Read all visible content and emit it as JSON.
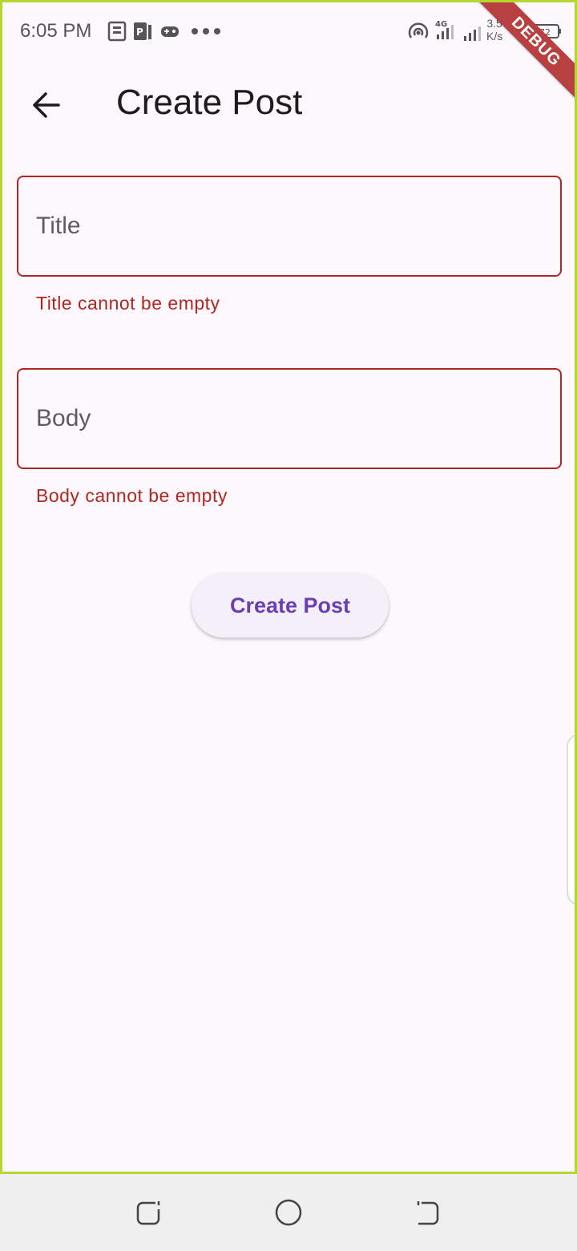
{
  "status_bar": {
    "time": "6:05 PM",
    "network_type": "4G",
    "speed_value": "3.5",
    "speed_unit": "K/s",
    "battery": "72",
    "debug_label": "DEBUG",
    "icons": [
      "news-icon",
      "pdf-icon",
      "game-icon",
      "more-dots-icon",
      "hotspot-icon",
      "signal-4g-icon",
      "signal-icon",
      "charging-icon",
      "battery-icon"
    ]
  },
  "app_bar": {
    "title": "Create Post",
    "back_icon": "arrow-back-icon"
  },
  "form": {
    "title_field": {
      "label": "Title",
      "value": "",
      "error": "Title cannot be empty"
    },
    "body_field": {
      "label": "Body",
      "value": "",
      "error": "Body cannot be empty"
    },
    "submit_label": "Create Post"
  },
  "colors": {
    "error": "#b3261e",
    "primary": "#6a3fb5",
    "background": "#fdf8fd"
  },
  "nav_bar": {
    "icons": [
      "recents-icon",
      "home-icon",
      "back-icon"
    ]
  }
}
